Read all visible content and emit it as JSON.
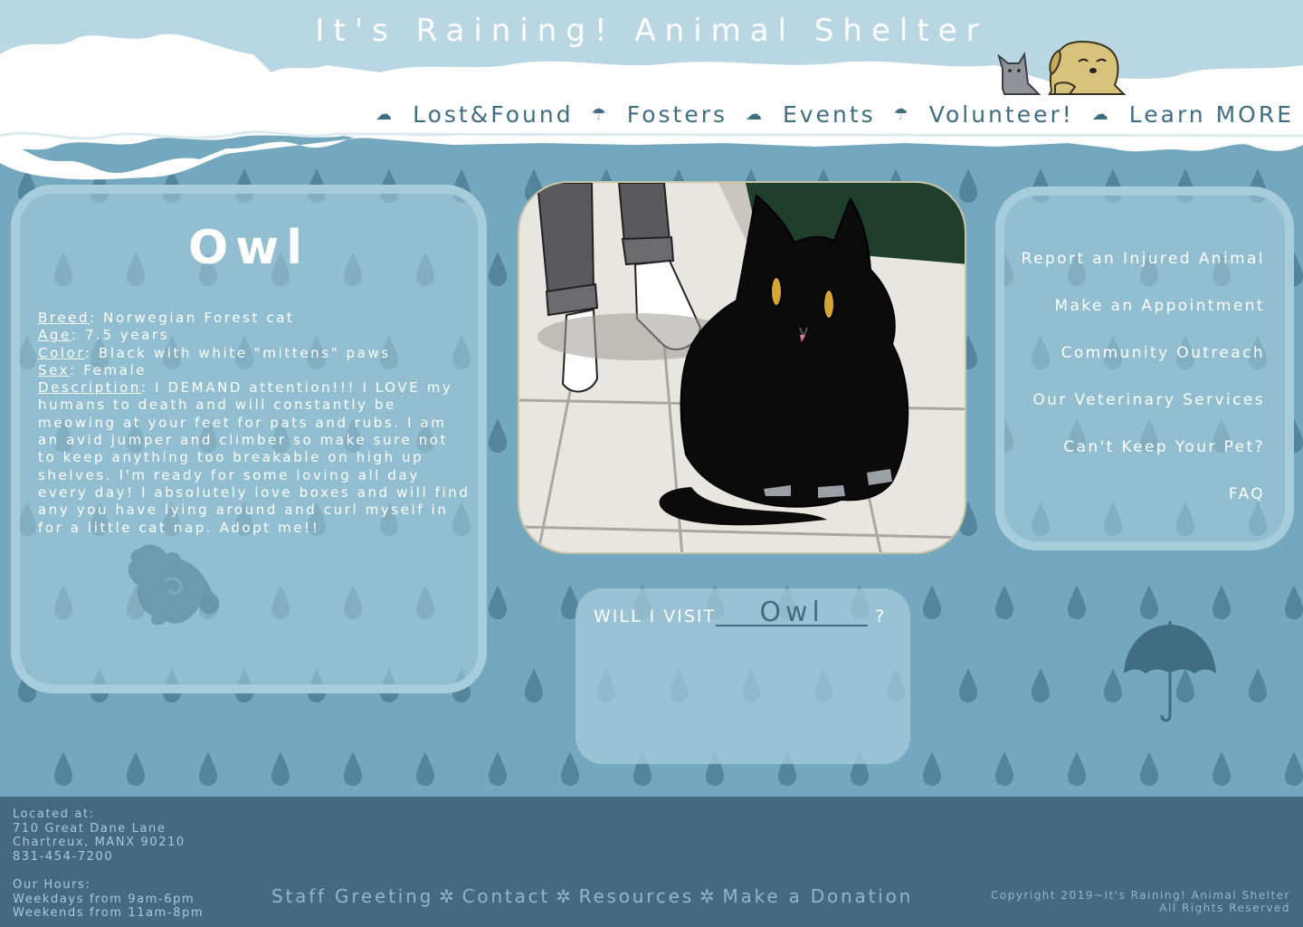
{
  "site": {
    "title": "It's Raining! Animal Shelter"
  },
  "nav": {
    "items": [
      {
        "label": "Lost&Found"
      },
      {
        "label": "Fosters"
      },
      {
        "label": "Events"
      },
      {
        "label": "Volunteer!"
      },
      {
        "label": "Learn MORE"
      }
    ]
  },
  "pet": {
    "name": "Owl",
    "breed_label": "Breed",
    "breed": "Norwegian Forest cat",
    "age_label": "Age",
    "age": "7.5 years",
    "color_label": "Color",
    "color": "Black with white \"mittens\" paws",
    "sex_label": "Sex",
    "sex": "Female",
    "description_label": "Description",
    "description": "I DEMAND attention!!! I LOVE my humans to death and will constantly be meowing at your feet for pats and rubs. I am an avid jumper and climber so make sure not to keep anything too breakable on high up shelves. I'm ready for some loving all day every day! I absolutely love boxes and will find any you have lying around and curl myself in for a little cat nap. Adopt me!!"
  },
  "sidebar": {
    "links": [
      {
        "label": "Report an Injured Animal"
      },
      {
        "label": "Make an Appointment"
      },
      {
        "label": "Community Outreach"
      },
      {
        "label": "Our Veterinary Services"
      },
      {
        "label": "Can't Keep Your Pet?"
      },
      {
        "label": "FAQ"
      }
    ]
  },
  "visit": {
    "prefix": "WILL I VISIT",
    "name": "Owl",
    "suffix": "?"
  },
  "footer": {
    "address_label": "Located at:",
    "address_line1": "710 Great Dane Lane",
    "address_line2": "Chartreux, MANX 90210",
    "phone": "831-454-7200",
    "hours_label": "Our Hours:",
    "hours_weekdays": "Weekdays from 9am-6pm",
    "hours_weekends": "Weekends from 11am-8pm",
    "links": [
      {
        "label": "Staff Greeting"
      },
      {
        "label": "Contact"
      },
      {
        "label": "Resources"
      },
      {
        "label": "Make a Donation"
      }
    ],
    "copyright_line1": "Copyright 2019~It's Raining! Animal Shelter",
    "copyright_line2": "All Rights Reserved"
  },
  "colors": {
    "background": "#74a8bf",
    "accent_dark": "#3f6d84",
    "footer": "#45697d",
    "cloud": "#ffffff"
  },
  "icons": {
    "nav_separators": [
      "cloud-icon",
      "umbrella-icon",
      "cloud-icon",
      "umbrella-icon",
      "cloud-icon"
    ],
    "footer_separator": "flower-icon"
  }
}
